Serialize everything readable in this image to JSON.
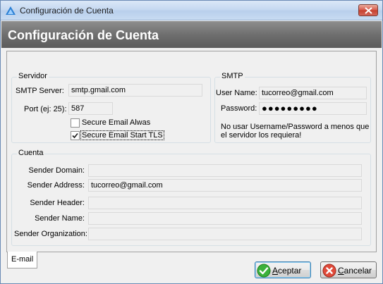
{
  "window": {
    "title": "Configuración de Cuenta"
  },
  "header": {
    "title": "Configuración de Cuenta"
  },
  "servidor": {
    "group_label": "Servidor",
    "smtp_server_label": "SMTP Server:",
    "smtp_server_value": "smtp.gmail.com",
    "port_label": "Port (ej: 25):",
    "port_value": "587",
    "secure_email_label": "Secure Email Alwas",
    "secure_email_checked": false,
    "secure_tls_label": "Secure Email Start TLS",
    "secure_tls_checked": true
  },
  "smtp": {
    "group_label": "SMTP",
    "user_name_label": "User Name:",
    "user_name_value": "tucorreo@gmail.com",
    "password_label": "Password:",
    "password_value": "●●●●●●●●●",
    "note_line1": "No usar Username/Password a menos que",
    "note_line2": "el servidor los requiera!"
  },
  "cuenta": {
    "group_label": "Cuenta",
    "sender_domain_label": "Sender Domain:",
    "sender_domain_value": "",
    "sender_address_label": "Sender Address:",
    "sender_address_value": "tucorreo@gmail.com",
    "sender_header_label": "Sender Header:",
    "sender_header_value": "",
    "sender_name_label": "Sender Name:",
    "sender_name_value": "",
    "sender_org_label": "Sender Organization:",
    "sender_org_value": ""
  },
  "tabs": [
    {
      "label": "E-mail",
      "selected": true
    }
  ],
  "buttons": {
    "accept_label": "Aceptar",
    "accept_mnemonic": "A",
    "accept_rest": "ceptar",
    "cancel_label": "Cancelar",
    "cancel_mnemonic": "C",
    "cancel_rest": "ancelar"
  },
  "icons": {
    "app": "app-logo-icon",
    "close": "close-icon",
    "accept": "checkmark-icon",
    "cancel": "cancel-icon"
  },
  "colors": {
    "header_band": "#6f6f6f",
    "close_button": "#c43d2c",
    "accept_icon": "#2e9e2e",
    "cancel_icon": "#d23b2b"
  }
}
